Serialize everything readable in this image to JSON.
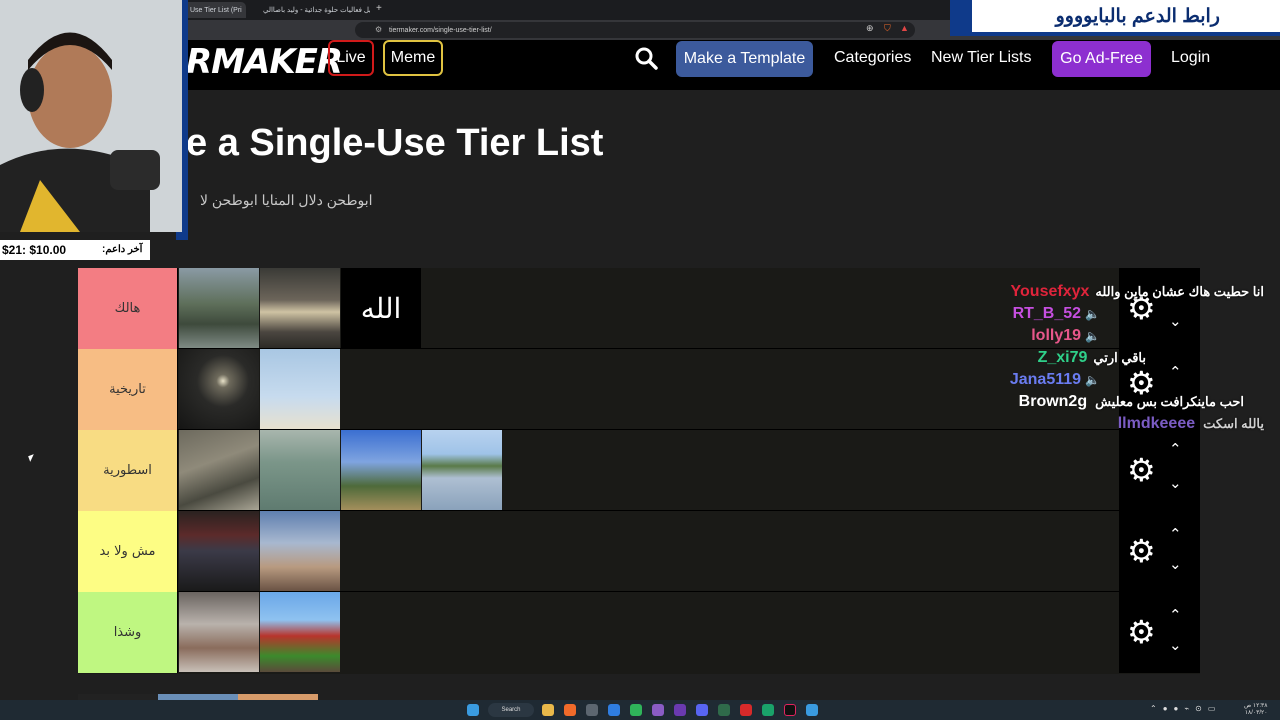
{
  "browser": {
    "tabs": [
      {
        "label": "Use Tier List (Pri",
        "active": true
      },
      {
        "label": "تشغيل فعاليات حلوة جدائية - وليد باصاالي",
        "active": false
      }
    ],
    "new_tab": "+",
    "url": "tiermaker.com/single-use-tier-list/"
  },
  "nav": {
    "logo": "RMAKER",
    "live": "Live",
    "meme": "Meme",
    "make_template": "Make a Template",
    "categories": "Categories",
    "new_tier_lists": "New Tier Lists",
    "go_ad_free": "Go Ad-Free",
    "login": "Login"
  },
  "page": {
    "title": "e a Single-Use Tier List",
    "subtitle": "ابوطحن دلال المنايا ابوطحن لا"
  },
  "tiers": [
    {
      "label": "هالك",
      "color": "#f37d83",
      "tiles": [
        "lake-mountains",
        "rainy-street",
        "calligraphy"
      ]
    },
    {
      "label": "تاريخية",
      "color": "#f7bd84",
      "tiles": [
        "night-moon",
        "minarets"
      ]
    },
    {
      "label": "اسطورية",
      "color": "#f8dc83",
      "tiles": [
        "rocky-shore",
        "sea",
        "palm-trees",
        "river"
      ]
    },
    {
      "label": "مش ولا بد",
      "color": "#fdfd84",
      "tiles": [
        "cinema-hall",
        "yellow-flower"
      ]
    },
    {
      "label": "وشذا",
      "color": "#bff781",
      "tiles": [
        "snowy-rails",
        "minecraft-house"
      ]
    }
  ],
  "calligraphy_text": "الله",
  "overlay": {
    "banner": "رابط الدعم بالبايوووو",
    "last_supporter_label": "آخر داعم:",
    "last_supporter_value": "$21: $10.00"
  },
  "chat": [
    {
      "name": "Yousefxyx",
      "color": "#e0243b",
      "message": "انا حطيت هاك عشان ماين والله"
    },
    {
      "name": "RT_B_52",
      "color": "#c64fe0",
      "message": ""
    },
    {
      "name": "lolly19",
      "color": "#e8578b",
      "message": ""
    },
    {
      "name": "Z_xi79",
      "color": "#2fd08a",
      "message": "باقي ارتي"
    },
    {
      "name": "Jana5119",
      "color": "#6a7cf0",
      "message": ""
    },
    {
      "name": "Brown2g",
      "color": "#ffffff",
      "message": "احب ماينكرافت بس معليش"
    },
    {
      "name": "llmdkeeee",
      "color": "#7b5cc4",
      "message": "يالله اسكت"
    }
  ],
  "taskbar": {
    "search": "Search",
    "time": "١٢:٣٨ ص",
    "date": "١٨/٠٣/٢٠"
  }
}
